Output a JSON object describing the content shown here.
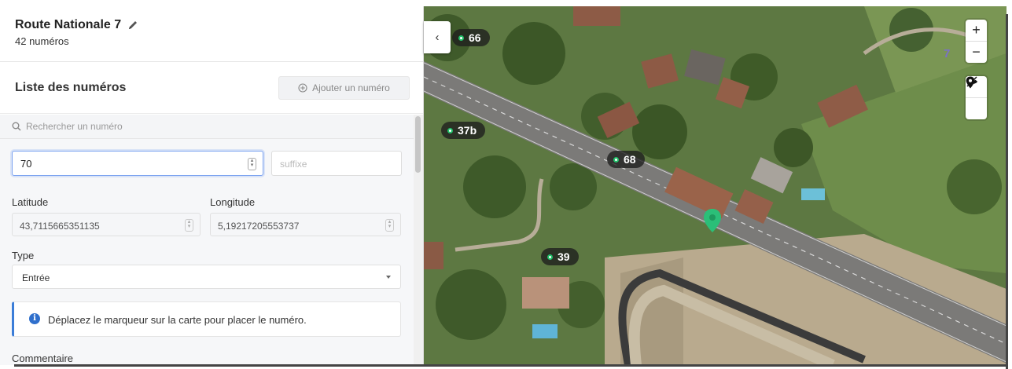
{
  "header": {
    "title": "Route Nationale 7",
    "count": "42 numéros",
    "icon": "pencil-icon"
  },
  "list": {
    "title": "Liste des numéros",
    "add_label": "Ajouter un numéro"
  },
  "search": {
    "placeholder": "Rechercher un numéro"
  },
  "form": {
    "number_value": "70",
    "suffix_placeholder": "suffixe",
    "latitude_label": "Latitude",
    "latitude_value": "43,7115665351135",
    "longitude_label": "Longitude",
    "longitude_value": "5,19217205553737",
    "type_label": "Type",
    "type_value": "Entrée",
    "info_text": "Déplacez le marqueur sur la carte pour placer le numéro.",
    "comment_label": "Commentaire"
  },
  "map": {
    "collapse_label": "‹",
    "zoom_in": "+",
    "zoom_out": "−",
    "house_numbers": [
      "66",
      "37b",
      "68",
      "39"
    ],
    "street_number_overlay": "7",
    "accent_color": "#23c16b",
    "marker_color": "#2bbf78"
  }
}
